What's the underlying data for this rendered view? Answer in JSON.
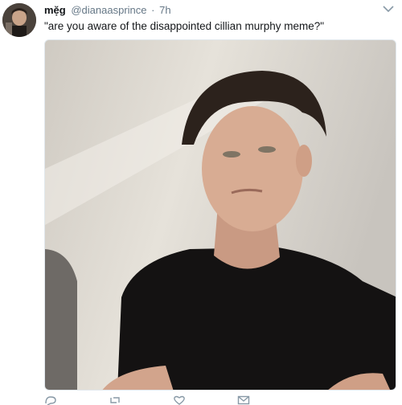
{
  "tweet": {
    "display_name": "mẹ̆g",
    "handle": "@dianaasprince",
    "separator": "·",
    "time": "7h",
    "text": "\"are you aware of the disappointed cillian murphy meme?\""
  },
  "icons": {
    "caret": "chevron-down-icon",
    "reply": "reply-icon",
    "retweet": "retweet-icon",
    "like": "heart-icon",
    "message": "mail-icon"
  },
  "colors": {
    "text": "#14171a",
    "secondary": "#657786"
  }
}
